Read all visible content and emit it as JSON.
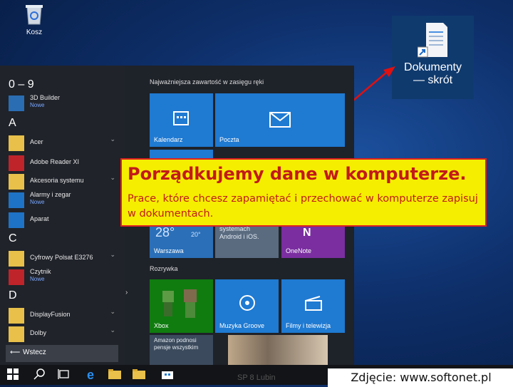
{
  "desktop": {
    "recycle_bin_label": "Kosz",
    "shortcut_label_line1": "Dokumenty",
    "shortcut_label_line2": "— skrót"
  },
  "start_menu": {
    "groups": [
      "0 – 9",
      "A",
      "C",
      "D"
    ],
    "apps": [
      {
        "name": "3D Builder",
        "sub": "Nowe"
      },
      {
        "name": "Acer"
      },
      {
        "name": "Adobe Reader XI"
      },
      {
        "name": "Akcesoria systemu"
      },
      {
        "name": "Alarmy i zegar",
        "sub": "Nowe"
      },
      {
        "name": "Aparat"
      },
      {
        "name": "Cyfrowy Polsat E3276"
      },
      {
        "name": "Czytnik",
        "sub": "Nowe"
      },
      {
        "name": "DisplayFusion"
      },
      {
        "name": "Dolby"
      }
    ],
    "back_label": "Wstecz",
    "tiles_header": "Najważniejsza zawartość w zasięgu ręki",
    "tiles": [
      "Kalendarz",
      "Poczta",
      "Warszawa",
      "OneNote"
    ],
    "weather_temp": "28°",
    "weather_small": "20°",
    "partial_text_1": "systemach",
    "partial_text_2": "Android i iOS.",
    "games_header": "Rozrywka",
    "game_tiles": [
      "Xbox",
      "Muzyka Groove",
      "Filmy i telewizja"
    ],
    "news_text": "Amazon podnosi pensje wszystkim"
  },
  "callout": {
    "title": "Porządkujemy dane w komputerze.",
    "body": "Prace, które chcesz zapamiętać i przechować w komputerze zapisuj w dokumentach."
  },
  "footer": {
    "text": "SP 8 Lubin"
  },
  "caption": "Zdjęcie: www.softonet.pl",
  "colors": {
    "callout_bg": "#f5ee00",
    "callout_text": "#c21a1a",
    "tile_blue": "#1f7ad2",
    "xbox_green": "#107c10"
  }
}
